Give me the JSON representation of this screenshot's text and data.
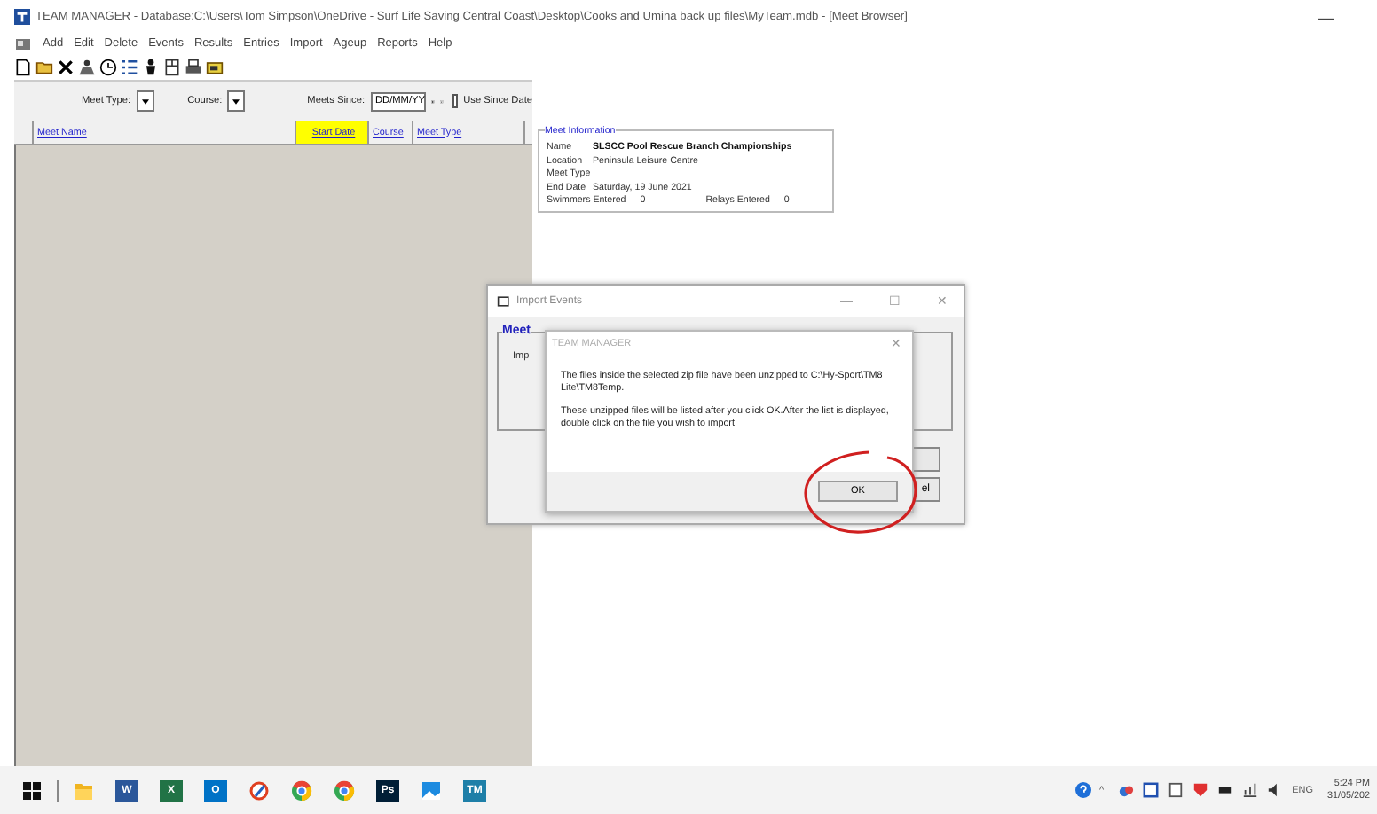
{
  "window": {
    "title": "TEAM MANAGER - Database:C:\\Users\\Tom Simpson\\OneDrive - Surf Life Saving Central Coast\\Desktop\\Cooks and Umina back up files\\MyTeam.mdb - [Meet Browser]",
    "minimize": "—"
  },
  "menu": [
    "Add",
    "Edit",
    "Delete",
    "Events",
    "Results",
    "Entries",
    "Import",
    "Ageup",
    "Reports",
    "Help"
  ],
  "filters": {
    "meet_type_label": "Meet Type:",
    "course_label": "Course:",
    "meets_since_label": "Meets Since:",
    "meets_since_value": "DD/MM/YY",
    "use_since_date": {
      "label": "Use Since Date",
      "checked": false
    }
  },
  "grid": {
    "columns": [
      {
        "label": "Meet Name",
        "selected": false
      },
      {
        "label": "Start Date",
        "selected": true
      },
      {
        "label": "Course",
        "selected": false
      },
      {
        "label": "Meet Type",
        "selected": false
      }
    ]
  },
  "meet_information": {
    "title": "Meet Information",
    "fields": [
      {
        "label": "Name",
        "value": "SLSCC Pool Rescue Branch Championships",
        "kind": "bold"
      },
      {
        "label": "Location",
        "value": "Peninsula Leisure Centre",
        "kind": "plain"
      },
      {
        "label": "Meet Type"
      },
      {
        "label": "End Date",
        "value": "Saturday, 19 June 2021",
        "kind": "plain"
      }
    ],
    "swimmers_label": "Swimmers Entered",
    "swimmers_value": "0",
    "relays_label": "Relays Entered",
    "relays_value": "0"
  },
  "import_dialog": {
    "title": "Import Events",
    "minimize": "—",
    "maximize": "☐",
    "close": "✕",
    "group_label": "Meet",
    "partial_text": "Imp",
    "partial_button": "el"
  },
  "message_dialog": {
    "title": "TEAM MANAGER",
    "close": "✕",
    "paragraphs": [
      "The files inside the selected zip file have been unzipped to C:\\Hy-Sport\\TM8 Lite\\TM8Temp.",
      "These unzipped files will be listed after you click OK.After the list is displayed, double click on the file you wish to import."
    ],
    "ok_button": "OK"
  },
  "taskbar": {
    "apps": [
      {
        "kind": "explorer"
      },
      {
        "kind": "tile",
        "color": "#2b579a",
        "label": "W"
      },
      {
        "kind": "tile",
        "color": "#217346",
        "label": "X"
      },
      {
        "kind": "tile",
        "color": "#0072c6",
        "label": "O"
      },
      {
        "kind": "paint"
      },
      {
        "kind": "chrome"
      },
      {
        "kind": "chrome"
      },
      {
        "kind": "tile",
        "color": "#001e36",
        "label": "Ps"
      },
      {
        "kind": "photos"
      },
      {
        "kind": "tile",
        "color": "#1e7fa8",
        "label": "TM"
      }
    ],
    "tray_caret": "^",
    "language": "ENG",
    "time": "5:24 PM",
    "date": "31/05/202"
  }
}
